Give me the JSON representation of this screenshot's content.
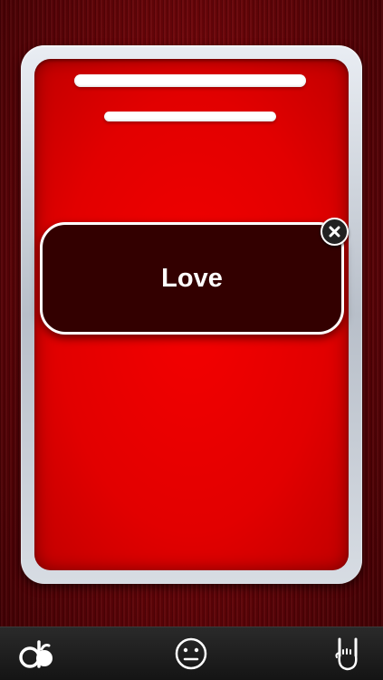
{
  "card": {
    "word": "Love",
    "face_color": "#e20000",
    "pill_color": "#330000"
  },
  "close_button": {
    "icon": "close-icon"
  },
  "bottom_bar": {
    "tabs": [
      {
        "icon": "app-logo-icon"
      },
      {
        "icon": "neutral-face-icon"
      },
      {
        "icon": "rock-hand-icon"
      }
    ]
  }
}
